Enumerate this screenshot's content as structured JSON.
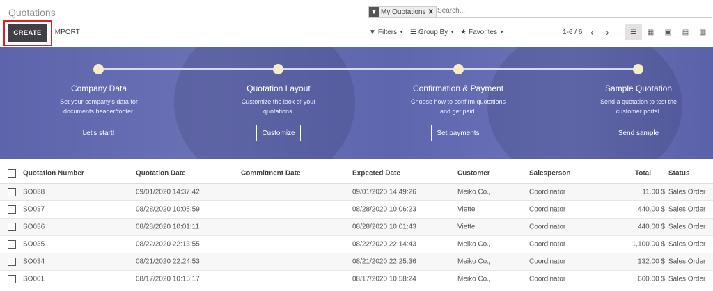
{
  "header": {
    "title": "Quotations",
    "facet_label": "My Quotations",
    "search_placeholder": "Search...",
    "create_label": "CREATE",
    "import_label": "IMPORT",
    "filters_label": "Filters",
    "groupby_label": "Group By",
    "favorites_label": "Favorites",
    "pager": "1-6 / 6"
  },
  "banner": {
    "steps": [
      {
        "title": "Company Data",
        "desc1": "Set your company's data for",
        "desc2": "documents header/footer.",
        "button": "Let's start!"
      },
      {
        "title": "Quotation Layout",
        "desc1": "Customize the look of your",
        "desc2": "quotations.",
        "button": "Customize"
      },
      {
        "title": "Confirmation & Payment",
        "desc1": "Choose how to confirm quotations",
        "desc2": "and get paid.",
        "button": "Set payments"
      },
      {
        "title": "Sample Quotation",
        "desc1": "Send a quotation to test the",
        "desc2": "customer portal.",
        "button": "Send sample"
      }
    ]
  },
  "table": {
    "columns": [
      "Quotation Number",
      "Quotation Date",
      "Commitment Date",
      "Expected Date",
      "Customer",
      "Salesperson",
      "Total",
      "Status"
    ],
    "rows": [
      {
        "number": "SO038",
        "qdate": "09/01/2020 14:37:42",
        "edate": "09/01/2020 14:49:26",
        "customer": "Meiko Co.,",
        "salesperson": "Coordinator",
        "total": "11.00 $",
        "status": "Sales Order"
      },
      {
        "number": "SO037",
        "qdate": "08/28/2020 10:05:59",
        "edate": "08/28/2020 10:06:23",
        "customer": "Viettel",
        "salesperson": "Coordinator",
        "total": "440.00 $",
        "status": "Sales Order"
      },
      {
        "number": "SO036",
        "qdate": "08/28/2020 10:01:11",
        "edate": "08/28/2020 10:01:43",
        "customer": "Viettel",
        "salesperson": "Coordinator",
        "total": "440.00 $",
        "status": "Sales Order"
      },
      {
        "number": "SO035",
        "qdate": "08/22/2020 22:13:55",
        "edate": "08/22/2020 22:14:43",
        "customer": "Meiko Co.,",
        "salesperson": "Coordinator",
        "total": "1,100.00 $",
        "status": "Sales Order"
      },
      {
        "number": "SO034",
        "qdate": "08/21/2020 22:24:53",
        "edate": "08/21/2020 22:25:36",
        "customer": "Meiko Co.,",
        "salesperson": "Coordinator",
        "total": "132.00 $",
        "status": "Sales Order"
      },
      {
        "number": "SO001",
        "qdate": "08/17/2020 10:15:17",
        "edate": "08/17/2020 10:58:24",
        "customer": "Meiko Co.,",
        "salesperson": "Coordinator",
        "total": "660.00 $",
        "status": "Sales Order"
      }
    ]
  },
  "colors": {
    "accent": "#3f3f45",
    "banner": "#6369b0",
    "highlight": "#e02020"
  }
}
